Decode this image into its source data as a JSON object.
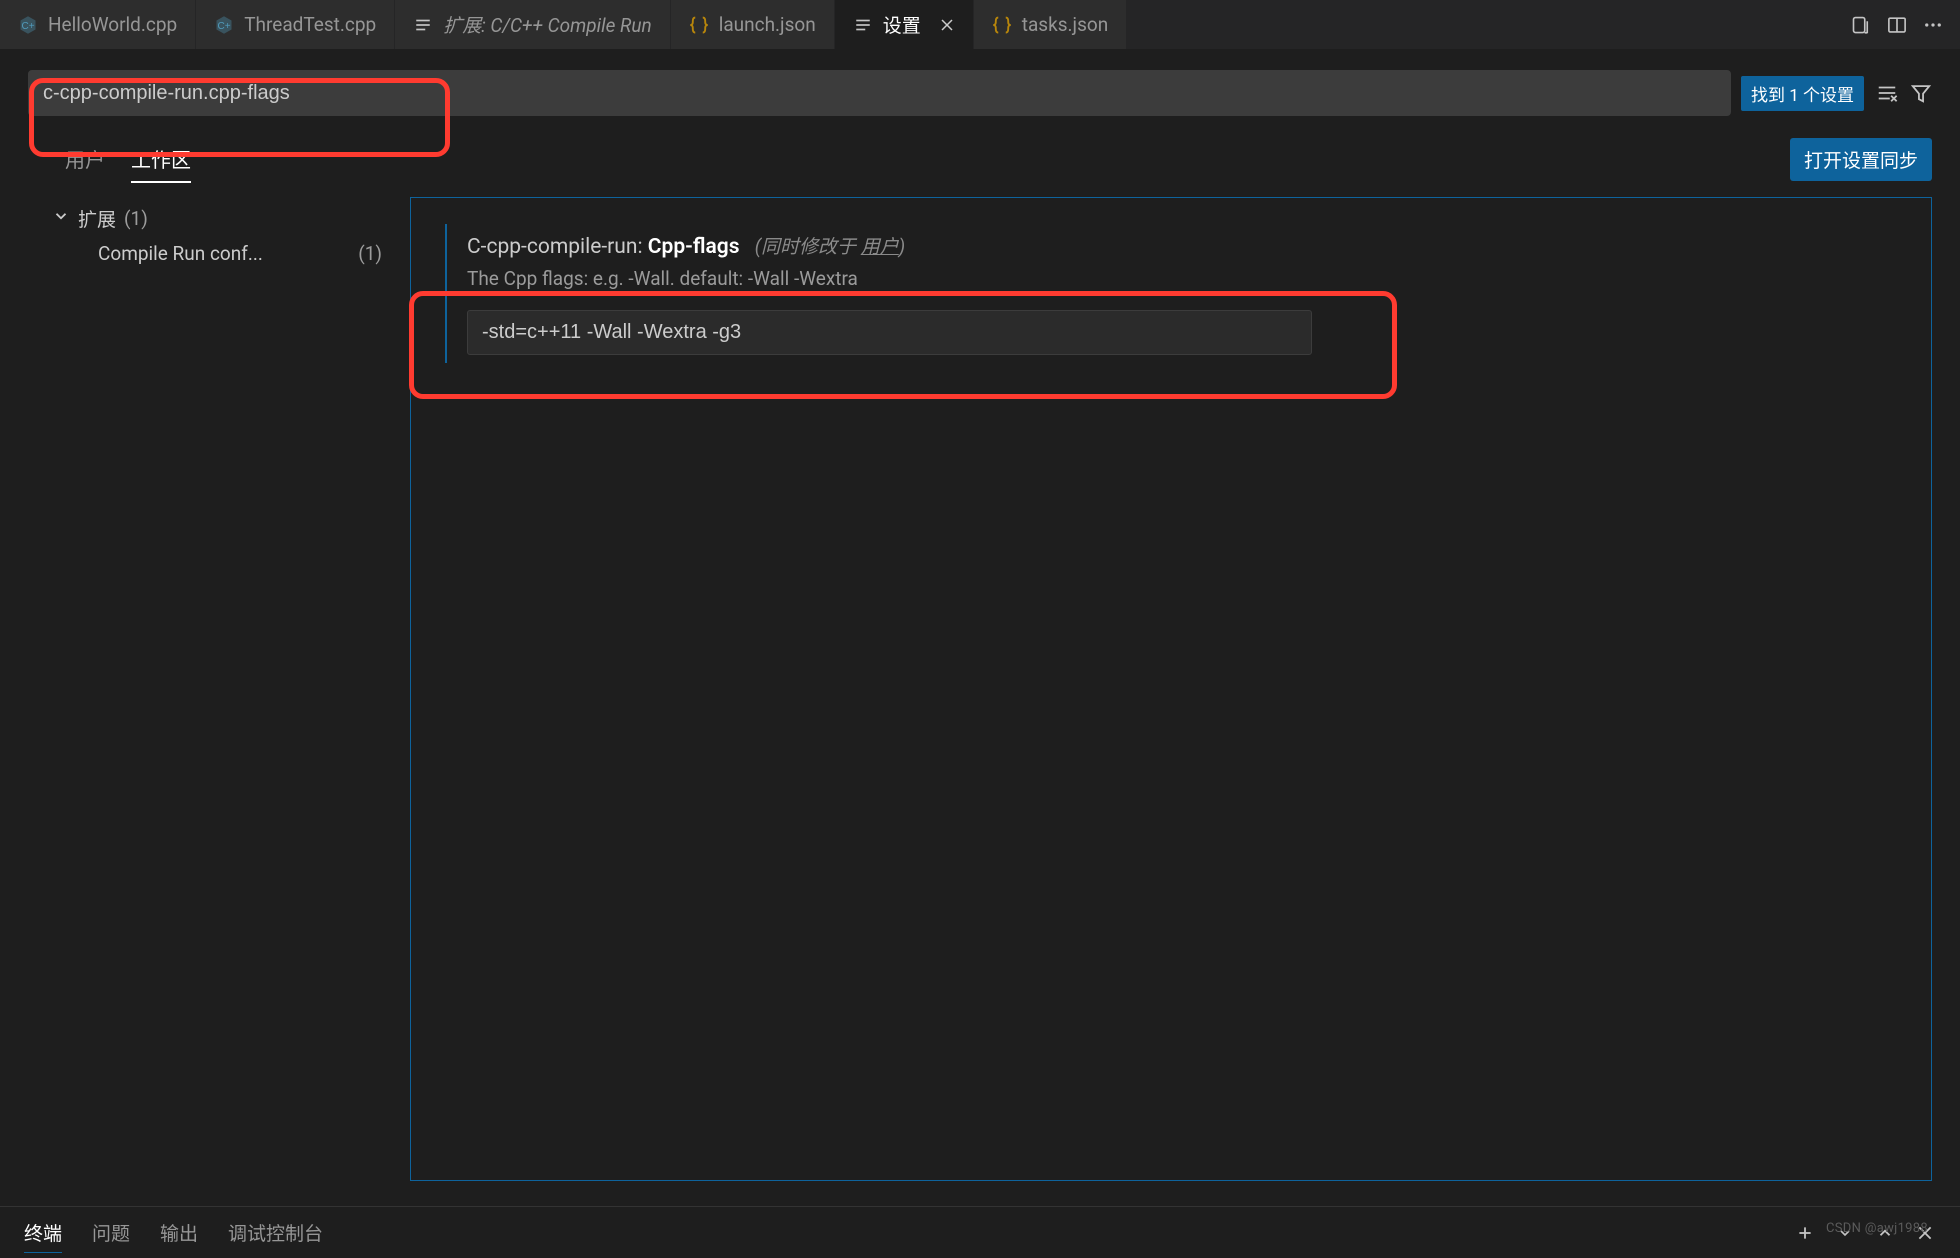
{
  "tabs": [
    {
      "label": "HelloWorld.cpp",
      "icon": "cpp"
    },
    {
      "label": "ThreadTest.cpp",
      "icon": "cpp"
    },
    {
      "label": "扩展: C/C++ Compile Run",
      "icon": "list",
      "italic": true
    },
    {
      "label": "launch.json",
      "icon": "json"
    },
    {
      "label": "设置",
      "icon": "list",
      "active": true
    },
    {
      "label": "tasks.json",
      "icon": "json"
    }
  ],
  "search": {
    "value": "c-cpp-compile-run.cpp-flags",
    "found_badge": "找到 1 个设置"
  },
  "scope": {
    "user_tab": "用户",
    "workspace_tab": "工作区",
    "sync_button": "打开设置同步"
  },
  "toc": {
    "group_label": "扩展",
    "group_count": "(1)",
    "child_label": "Compile Run conf...",
    "child_count": "(1)"
  },
  "setting": {
    "key": "C-cpp-compile-run:",
    "sub": "Cpp-flags",
    "note_prefix": "(同时修改于 ",
    "note_link": "用户",
    "note_suffix": ")",
    "description": "The Cpp flags: e.g. -Wall. default: -Wall -Wextra",
    "value": "-std=c++11 -Wall -Wextra -g3"
  },
  "bottom": {
    "terminal": "终端",
    "problems": "问题",
    "output": "输出",
    "debug_console": "调试控制台"
  },
  "watermark": "CSDN @awj1988"
}
